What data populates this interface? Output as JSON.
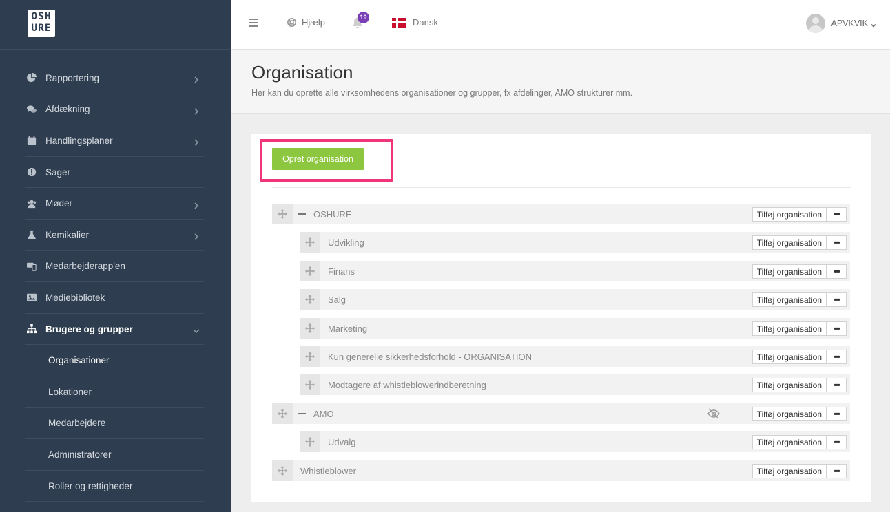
{
  "logo": {
    "line1": "OSH",
    "line2": "URE"
  },
  "sidebar": {
    "items": [
      {
        "label": "Rapportering",
        "icon": "pie-chart-icon"
      },
      {
        "label": "Afdækning",
        "icon": "chat-bubbles-icon"
      },
      {
        "label": "Handlingsplaner",
        "icon": "calendar-icon"
      },
      {
        "label": "Sager",
        "icon": "exclamation-circle-icon"
      },
      {
        "label": "Møder",
        "icon": "people-icon"
      },
      {
        "label": "Kemikalier",
        "icon": "flask-icon"
      },
      {
        "label": "Medarbejderapp'en",
        "icon": "devices-icon"
      },
      {
        "label": "Mediebibliotek",
        "icon": "image-icon"
      },
      {
        "label": "Brugere og grupper",
        "icon": "org-chart-icon"
      }
    ],
    "subitems": [
      "Organisationer",
      "Lokationer",
      "Medarbejdere",
      "Administratorer",
      "Roller og rettigheder"
    ]
  },
  "topbar": {
    "help": "Hjælp",
    "notifications": "19",
    "language": "Dansk",
    "user": "APVKVIK"
  },
  "header": {
    "title": "Organisation",
    "subtitle": "Her kan du oprette alle virksomhedens organisationer og grupper, fx afdelinger, AMO strukturer mm."
  },
  "main": {
    "create_button": "Opret organisation",
    "add_label": "Tilføj organisation",
    "more_label": "•••",
    "tree": [
      {
        "label": "OSHURE",
        "level": 0,
        "collapsible": true
      },
      {
        "label": "Udvikling",
        "level": 1
      },
      {
        "label": "Finans",
        "level": 1
      },
      {
        "label": "Salg",
        "level": 1
      },
      {
        "label": "Marketing",
        "level": 1
      },
      {
        "label": "Kun generelle sikkerhedsforhold - ORGANISATION",
        "level": 1
      },
      {
        "label": "Modtagere af whistleblowerindberetning",
        "level": 1
      },
      {
        "label": "AMO",
        "level": 0,
        "collapsible": true,
        "hidden_icon": true
      },
      {
        "label": "Udvalg",
        "level": 1
      },
      {
        "label": "Whistleblower",
        "level": 0
      }
    ]
  },
  "colors": {
    "sidebar": "#2e3d4f",
    "accent_green": "#8dc63f",
    "highlight": "#f0357a",
    "badge": "#7a3fb6"
  }
}
